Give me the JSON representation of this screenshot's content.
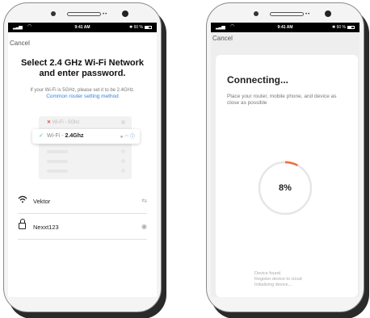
{
  "status_bar": {
    "time_left": "9:41 AM",
    "battery_left": "60 %",
    "time_right": "9:41 AM",
    "battery_right": "60 %"
  },
  "colors": {
    "accent": "#3a7fd5",
    "progress": "#ee6b3b",
    "check": "#2ecc71",
    "error": "#e74c3c"
  },
  "wifi_setup": {
    "cancel_label": "Cancel",
    "title_line1": "Select 2.4 GHz Wi-Fi Network",
    "title_line2": "and enter password.",
    "subtitle": "If your Wi-Fi is 5GHz, please set it to be 2.4GHz.",
    "router_link": "Common router setting method",
    "illustration": {
      "network_5g_prefix": "Wi-Fi - ",
      "network_5g_name": "5Ghz",
      "network_24_prefix": "Wi-Fi - ",
      "network_24_name": "2.4Ghz"
    },
    "ssid_value": "Vektor",
    "password_value": "Nexxt123"
  },
  "connecting": {
    "cancel_label": "Cancel",
    "title": "Connecting...",
    "description": "Place your router, mobile phone, and device as close as possible",
    "progress_percent": 8,
    "progress_label": "8%",
    "steps": [
      "Device found",
      "Register device to cloud",
      "Initializing device..."
    ]
  }
}
